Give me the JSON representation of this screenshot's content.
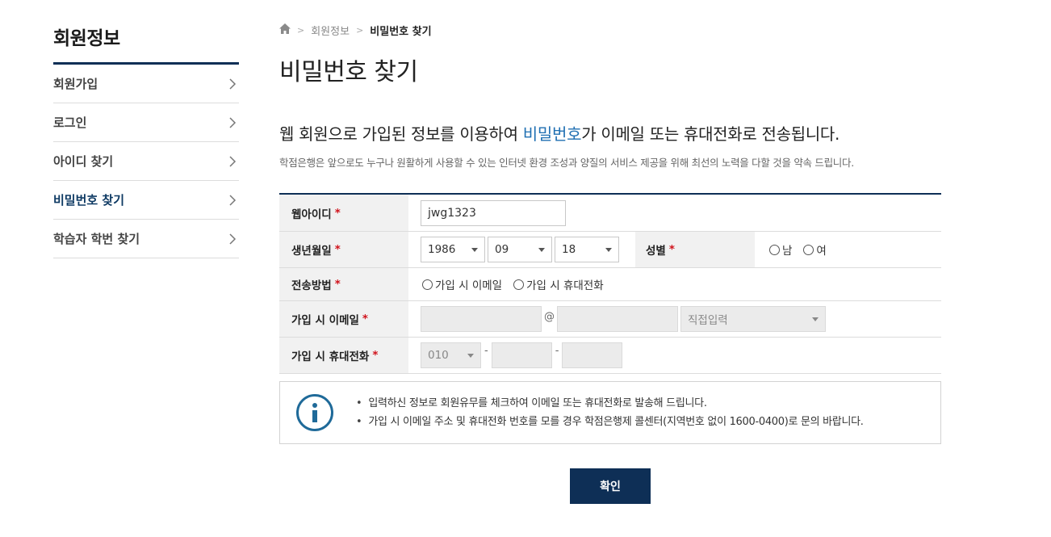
{
  "sidebar": {
    "title": "회원정보",
    "items": [
      {
        "label": "회원가입"
      },
      {
        "label": "로그인"
      },
      {
        "label": "아이디 찾기"
      },
      {
        "label": "비밀번호 찾기"
      },
      {
        "label": "학습자 학번 찾기"
      }
    ],
    "active_index": 3
  },
  "breadcrumb": {
    "icon": "home-icon",
    "section": "회원정보",
    "current": "비밀번호 찾기"
  },
  "page_title": "비밀번호 찾기",
  "lead": {
    "before": "웹 회원으로 가입된 정보를 이용하여 ",
    "highlight": "비밀번호",
    "after": "가 이메일 또는 휴대전화로 전송됩니다."
  },
  "description": "학점은행은 앞으로도 누구나 원활하게 사용할 수 있는 인터넷 환경 조성과 양질의 서비스 제공을 위해 최선의 노력을 다할 것을 약속 드립니다.",
  "required_mark": "*",
  "form": {
    "web_id": {
      "label": "웹아이디",
      "value": "jwg1323"
    },
    "birth": {
      "label": "생년월일",
      "year": "1986",
      "month": "09",
      "day": "18"
    },
    "gender": {
      "label": "성별",
      "options": [
        "남",
        "여"
      ]
    },
    "method": {
      "label": "전송방법",
      "options": [
        "가입 시 이메일",
        "가입 시 휴대전화"
      ]
    },
    "email": {
      "label": "가입 시 이메일",
      "at": "@",
      "domain_select": "직접입력"
    },
    "phone": {
      "label": "가입 시 휴대전화",
      "prefix": "010",
      "dash": "-"
    }
  },
  "info": [
    "입력하신 정보로 회원유무를 체크하여 이메일 또는 휴대전화로 발송해 드립니다.",
    "가입 시 이메일 주소 및 휴대전화 번호를 모를 경우 학점은행제 콜센터(지역번호 없이 1600-0400)로 문의 바랍니다."
  ],
  "confirm_label": "확인",
  "colors": {
    "navy": "#0e2f56",
    "highlight": "#1f6fb2",
    "required": "#d0121b"
  }
}
